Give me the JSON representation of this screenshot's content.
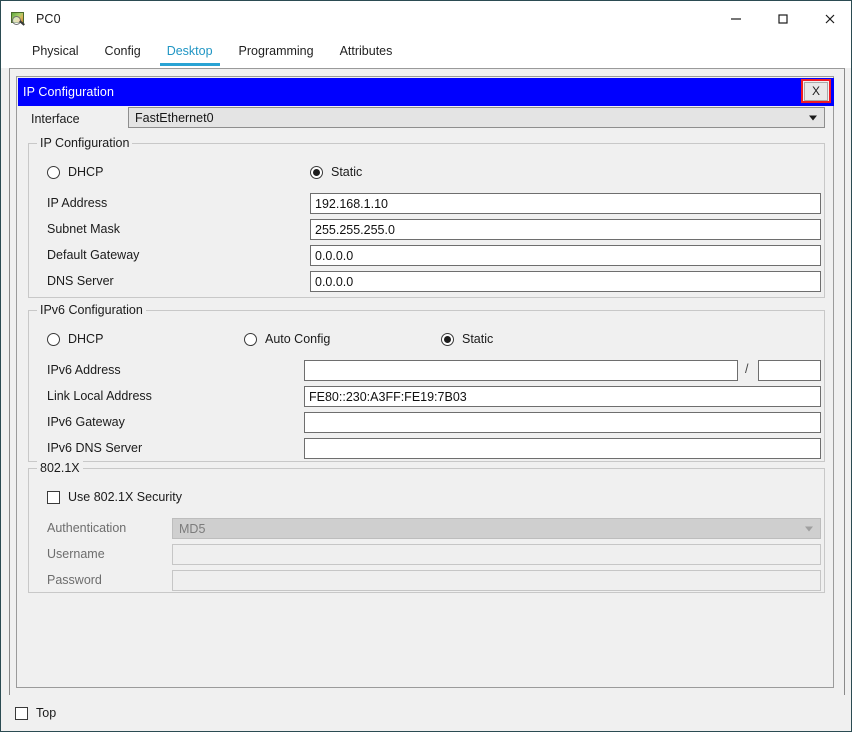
{
  "window": {
    "title": "PC0",
    "icon": "packet-tracer-pc-icon",
    "minimize_label": "—",
    "maximize_label": "□",
    "close_label": "✕"
  },
  "tabs": [
    {
      "label": "Physical",
      "active": false
    },
    {
      "label": "Config",
      "active": false
    },
    {
      "label": "Desktop",
      "active": true
    },
    {
      "label": "Programming",
      "active": false
    },
    {
      "label": "Attributes",
      "active": false
    }
  ],
  "dialog": {
    "title": "IP Configuration",
    "close_label": "X",
    "close_highlight_color": "#ee1c24",
    "titlebar_color": "#0000ff"
  },
  "interface": {
    "label": "Interface",
    "value": "FastEthernet0"
  },
  "ip_configuration": {
    "group_label": "IP Configuration",
    "mode_dhcp": "DHCP",
    "mode_static": "Static",
    "selected_mode": "Static",
    "fields": [
      {
        "label": "IP Address",
        "value": "192.168.1.10"
      },
      {
        "label": "Subnet Mask",
        "value": "255.255.255.0"
      },
      {
        "label": "Default Gateway",
        "value": "0.0.0.0"
      },
      {
        "label": "DNS Server",
        "value": "0.0.0.0"
      }
    ]
  },
  "ipv6_configuration": {
    "group_label": "IPv6 Configuration",
    "mode_dhcp": "DHCP",
    "mode_auto": "Auto Config",
    "mode_static": "Static",
    "selected_mode": "Static",
    "separator": "/",
    "fields": [
      {
        "label": "IPv6 Address",
        "value": ""
      },
      {
        "label": "Link Local Address",
        "value": "FE80::230:A3FF:FE19:7B03"
      },
      {
        "label": "IPv6 Gateway",
        "value": ""
      },
      {
        "label": "IPv6 DNS Server",
        "value": ""
      }
    ],
    "prefix_value": ""
  },
  "dot1x": {
    "group_label": "802.1X",
    "use_security_label": "Use 802.1X Security",
    "use_security_checked": false,
    "authentication_label": "Authentication",
    "authentication_value": "MD5",
    "username_label": "Username",
    "username_value": "",
    "password_label": "Password",
    "password_value": ""
  },
  "footer": {
    "top_label": "Top",
    "top_checked": false
  }
}
